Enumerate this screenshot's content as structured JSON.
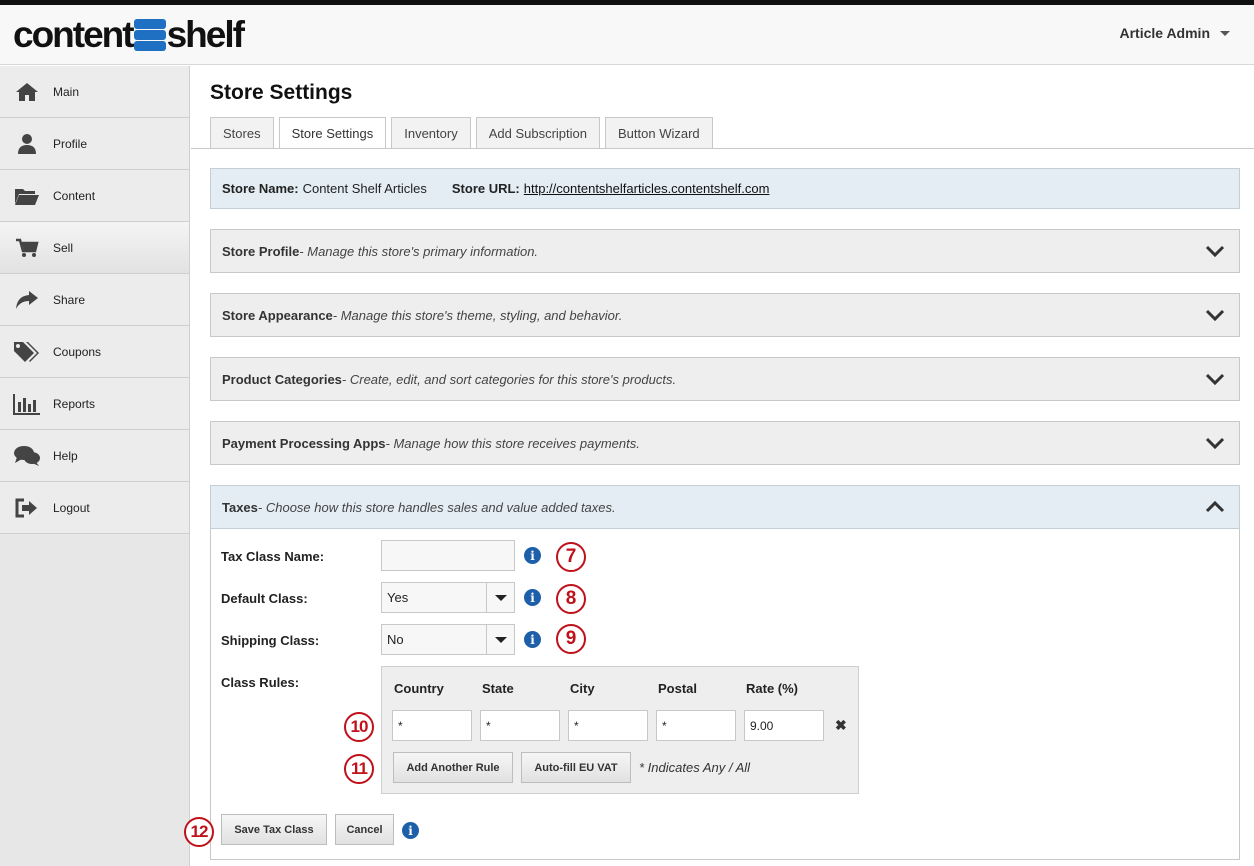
{
  "header": {
    "logo_left": "content",
    "logo_right": "shelf",
    "user_menu": "Article Admin"
  },
  "sidebar": {
    "items": [
      {
        "label": "Main",
        "icon": "home-icon"
      },
      {
        "label": "Profile",
        "icon": "user-icon"
      },
      {
        "label": "Content",
        "icon": "folder-icon"
      },
      {
        "label": "Sell",
        "icon": "cart-icon"
      },
      {
        "label": "Share",
        "icon": "share-icon"
      },
      {
        "label": "Coupons",
        "icon": "tags-icon"
      },
      {
        "label": "Reports",
        "icon": "bar-chart-icon"
      },
      {
        "label": "Help",
        "icon": "chat-icon"
      },
      {
        "label": "Logout",
        "icon": "logout-icon"
      }
    ],
    "active": "Sell"
  },
  "page": {
    "title": "Store Settings",
    "tabs": [
      "Stores",
      "Store Settings",
      "Inventory",
      "Add Subscription",
      "Button Wizard"
    ],
    "active_tab": "Store Settings"
  },
  "store_info": {
    "name_label": "Store Name:",
    "name_value": "Content Shelf Articles",
    "url_label": "Store URL:",
    "url_value": "http://contentshelfarticles.contentshelf.com"
  },
  "sections": [
    {
      "title": "Store Profile",
      "desc": " - Manage this store's primary information."
    },
    {
      "title": "Store Appearance",
      "desc": " - Manage this store's theme, styling, and behavior."
    },
    {
      "title": "Product Categories",
      "desc": " - Create, edit, and sort categories for this store's products."
    },
    {
      "title": "Payment Processing Apps",
      "desc": " - Manage how this store receives payments."
    },
    {
      "title": "Taxes",
      "desc": " - Choose how this store handles sales and value added taxes."
    }
  ],
  "taxes": {
    "tax_class_name_label": "Tax Class Name:",
    "tax_class_name_value": "",
    "default_class_label": "Default Class:",
    "default_class_value": "Yes",
    "shipping_class_label": "Shipping Class:",
    "shipping_class_value": "No",
    "class_rules_label": "Class Rules:",
    "columns": [
      "Country",
      "State",
      "City",
      "Postal",
      "Rate (%)"
    ],
    "rule": [
      "*",
      "*",
      "*",
      "*",
      "9.00"
    ],
    "add_rule_button": "Add Another Rule",
    "autofill_button": "Auto-fill EU VAT",
    "note": "* Indicates Any / All",
    "save_button": "Save Tax Class",
    "cancel_button": "Cancel",
    "info_glyph": "i",
    "delete_glyph": "✖"
  },
  "callouts": [
    "7",
    "8",
    "9",
    "10",
    "11",
    "12"
  ],
  "colors": {
    "accent_blue": "#1d5fa8",
    "callout_red": "#c0111a",
    "open_section_bg": "#e3edf3"
  }
}
